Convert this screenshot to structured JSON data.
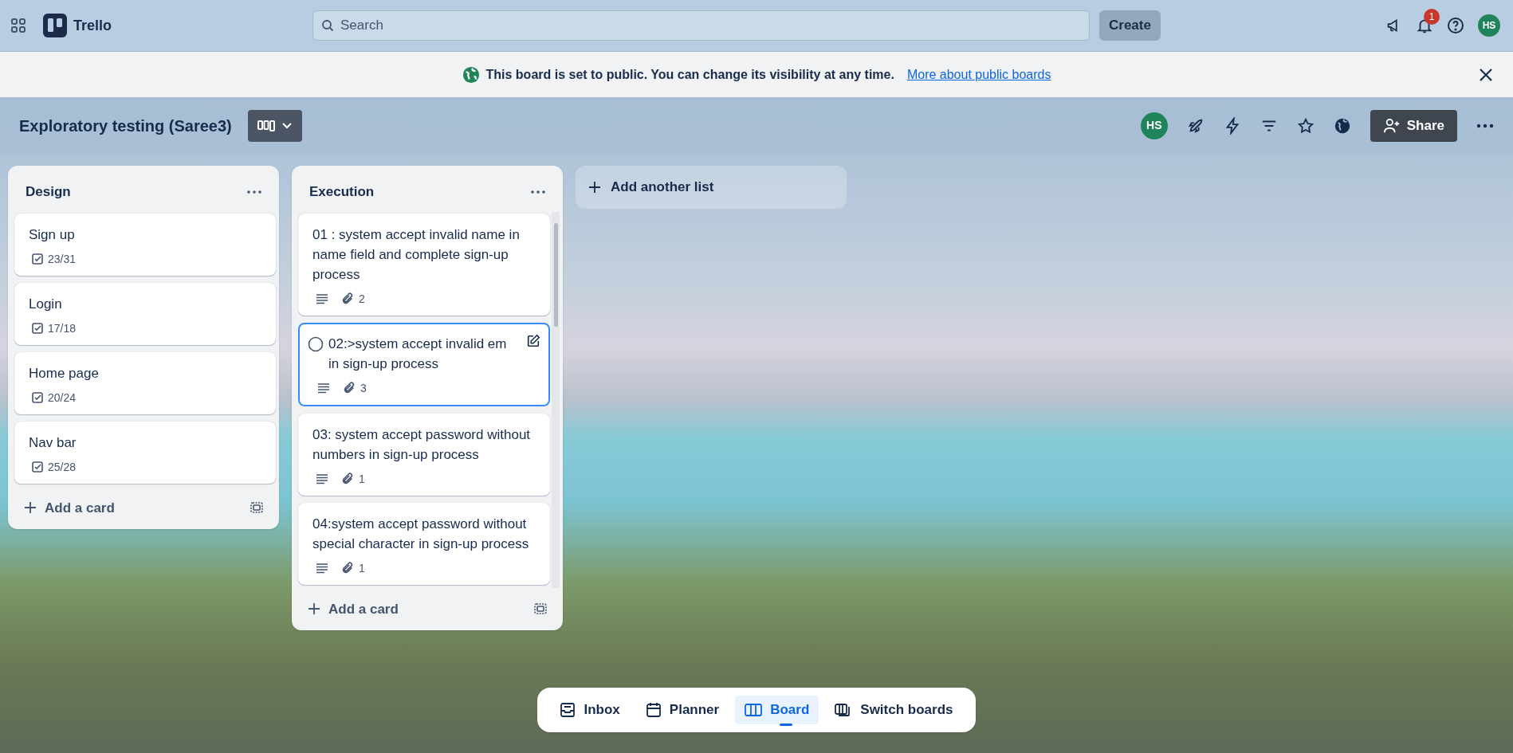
{
  "header": {
    "app_name": "Trello",
    "search_placeholder": "Search",
    "create_button": "Create",
    "notification_count": "1",
    "avatar": "HS"
  },
  "banner": {
    "message": "This board is set to public. You can change its visibility at any time.",
    "link": "More about public boards"
  },
  "board": {
    "title": "Exploratory testing (Saree3)",
    "member_avatar": "HS",
    "share_button": "Share"
  },
  "lists": [
    {
      "title": "Design",
      "add_card": "Add a card",
      "cards": [
        {
          "title": "Sign up",
          "checklist": "23/31",
          "selected": false
        },
        {
          "title": "Login",
          "checklist": "17/18",
          "selected": false
        },
        {
          "title": "Home page",
          "checklist": "20/24",
          "selected": false
        },
        {
          "title": "Nav bar",
          "checklist": "25/28",
          "selected": false
        }
      ]
    },
    {
      "title": "Execution",
      "add_card": "Add a card",
      "cards": [
        {
          "title": "01 : system accept invalid name in name field and complete sign-up process",
          "has_description": true,
          "attachments": "2",
          "selected": false
        },
        {
          "title": "02:>system accept invalid em\nin sign-up process",
          "has_description": true,
          "attachments": "3",
          "selected": true
        },
        {
          "title": "03: system accept password without numbers in sign-up process",
          "has_description": true,
          "attachments": "1",
          "selected": false
        },
        {
          "title": "04:system accept password without special character in sign-up process",
          "has_description": true,
          "attachments": "1",
          "selected": false
        }
      ]
    }
  ],
  "add_list": "Add another list",
  "bottom_nav": [
    {
      "label": "Inbox",
      "selected": false
    },
    {
      "label": "Planner",
      "selected": false
    },
    {
      "label": "Board",
      "selected": true
    },
    {
      "label": "Switch boards",
      "selected": false
    }
  ]
}
